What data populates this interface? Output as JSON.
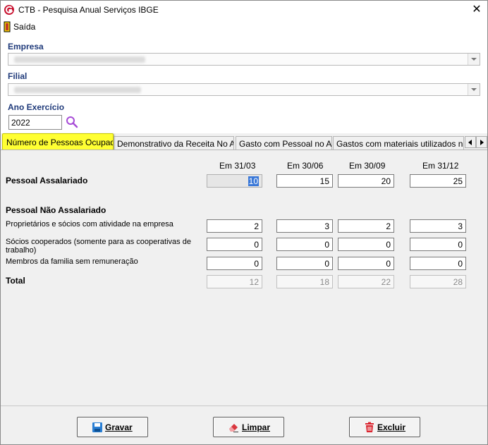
{
  "window": {
    "title": "CTB - Pesquisa Anual Serviços IBGE",
    "close_glyph": "✕"
  },
  "menu": {
    "saida_label": "Saída"
  },
  "form": {
    "empresa_label": "Empresa",
    "filial_label": "Filial",
    "ano_label": "Ano Exercício",
    "ano_value": "2022"
  },
  "tabs": [
    {
      "label": "Número de Pessoas Ocupadas",
      "active": true
    },
    {
      "label": "Demonstrativo da Receita No Ano"
    },
    {
      "label": "Gasto com Pessoal no Ano"
    },
    {
      "label": "Gastos com materiais utilizados na pre"
    }
  ],
  "grid": {
    "columns": [
      "Em 31/03",
      "Em 30/06",
      "Em 30/09",
      "Em 31/12"
    ],
    "assalariado": {
      "label": "Pessoal Assalariado",
      "values": [
        "10",
        "15",
        "20",
        "25"
      ]
    },
    "nao_assalariado_header": "Pessoal Não Assalariado",
    "proprietarios": {
      "label": "Proprietários e sócios com atividade na empresa",
      "values": [
        "2",
        "3",
        "2",
        "3"
      ]
    },
    "cooperados": {
      "label": "Sócios cooperados (somente para as cooperativas de trabalho)",
      "values": [
        "0",
        "0",
        "0",
        "0"
      ]
    },
    "familia": {
      "label": "Membros da familia sem remuneração",
      "values": [
        "0",
        "0",
        "0",
        "0"
      ]
    },
    "total": {
      "label": "Total",
      "values": [
        "12",
        "18",
        "22",
        "28"
      ]
    }
  },
  "buttons": {
    "gravar": "Gravar",
    "limpar": "Limpar",
    "excluir": "Excluir"
  },
  "colors": {
    "label_blue": "#1f3a7a",
    "active_tab": "#ffff33",
    "selection": "#3a78d8"
  },
  "icons": [
    "app-logo-icon",
    "exit-door-icon",
    "search-icon",
    "save-disk-icon",
    "eraser-icon",
    "trash-icon"
  ]
}
